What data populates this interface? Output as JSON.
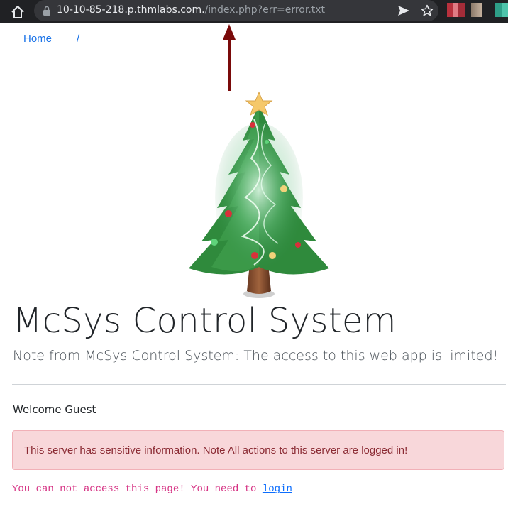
{
  "browser": {
    "url_host": "10-10-85-218.p.thmlabs.com.",
    "url_path": "/index.php?err=error.txt"
  },
  "nav": {
    "home": "Home",
    "separator": "/"
  },
  "page": {
    "title": "McSys Control System",
    "lead": "Note from McSys Control System: The access to this web app is limited!",
    "welcome": "Welcome Guest",
    "alert": "This server has sensitive information. Note All actions to this server are logged in!",
    "notice_text": "You can not access this page! You need to ",
    "login_link": "login"
  },
  "colors": {
    "link": "#1a73e8",
    "alert_bg": "#f8d7da",
    "alert_text": "#8a2a33",
    "notice": "#d63384",
    "arrow": "#7a0a0a"
  }
}
